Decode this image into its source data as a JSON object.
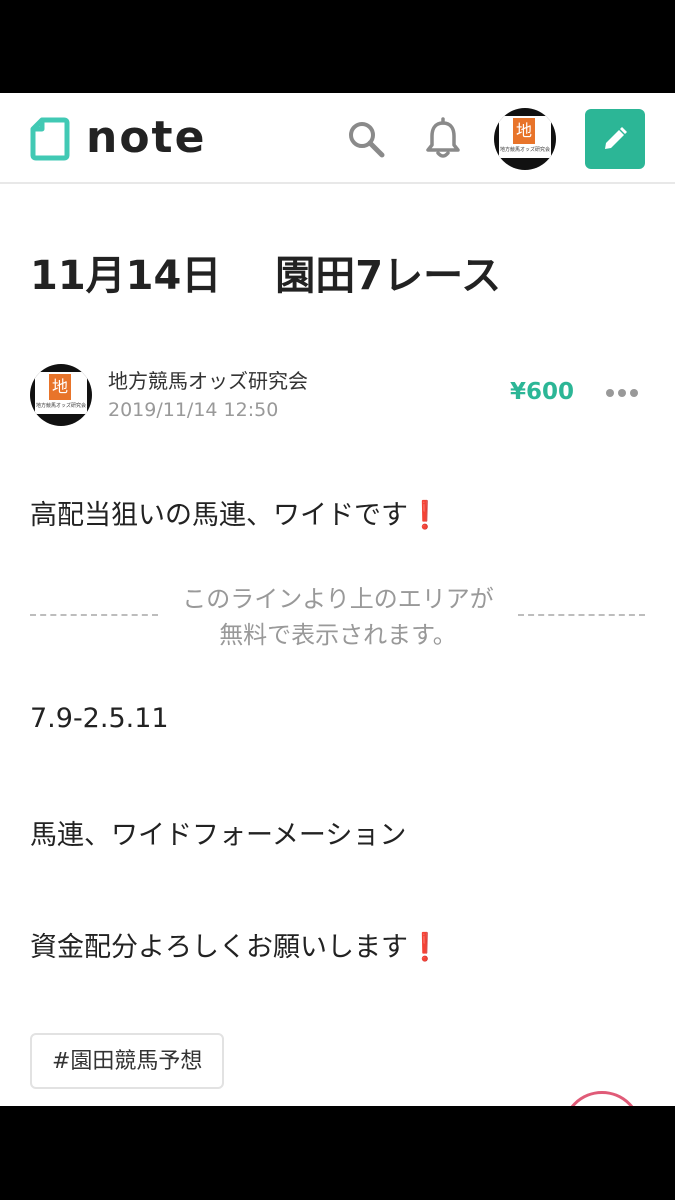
{
  "header": {
    "logo_text": "note",
    "avatar_badge": "地",
    "avatar_sub": "地方競馬オッズ研究会"
  },
  "article": {
    "title": "11月14日　 園田7レース",
    "author_name": "地方競馬オッズ研究会",
    "date": "2019/11/14 12:50",
    "price": "¥600",
    "intro_text": "高配当狙いの馬連、ワイドです",
    "intro_emoji": "❗",
    "paywall_line1": "このラインより上のエリアが",
    "paywall_line2": "無料で表示されます。",
    "numbers": "7.9-2.5.11",
    "bet_type": "馬連、ワイドフォーメーション",
    "closing_text": "資金配分よろしくお願いします",
    "closing_emoji": "❗",
    "hashtag": "#園田競馬予想"
  },
  "colors": {
    "accent": "#2cb696",
    "emoji_red": "#d6141e",
    "like": "#e05b78"
  }
}
